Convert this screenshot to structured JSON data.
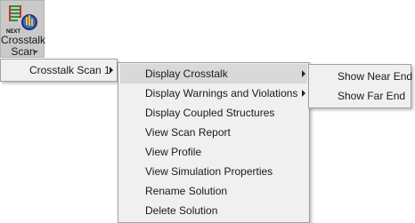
{
  "ribbon": {
    "button_line1": "Crosstalk",
    "button_line2": "Scan",
    "icon_text": "NEXT",
    "icon": "crosstalk-scan-icon"
  },
  "menu_level1": {
    "items": [
      {
        "label": "Crosstalk Scan 1",
        "has_submenu": true
      }
    ]
  },
  "menu_level2": {
    "items": [
      {
        "label": "Display Crosstalk",
        "has_submenu": true,
        "highlighted": true
      },
      {
        "label": "Display Warnings and Violations",
        "has_submenu": true
      },
      {
        "label": "Display Coupled Structures"
      },
      {
        "label": "View Scan Report"
      },
      {
        "label": "View Profile"
      },
      {
        "label": "View Simulation Properties"
      },
      {
        "label": "Rename Solution"
      },
      {
        "label": "Delete Solution"
      }
    ]
  },
  "menu_level3": {
    "items": [
      {
        "label": "Show Near End"
      },
      {
        "label": "Show Far End"
      }
    ]
  },
  "colors": {
    "menu_bg": "#f0f0f0",
    "highlight": "#d9d9d9",
    "ribbon_bg": "#c9c9c9"
  }
}
